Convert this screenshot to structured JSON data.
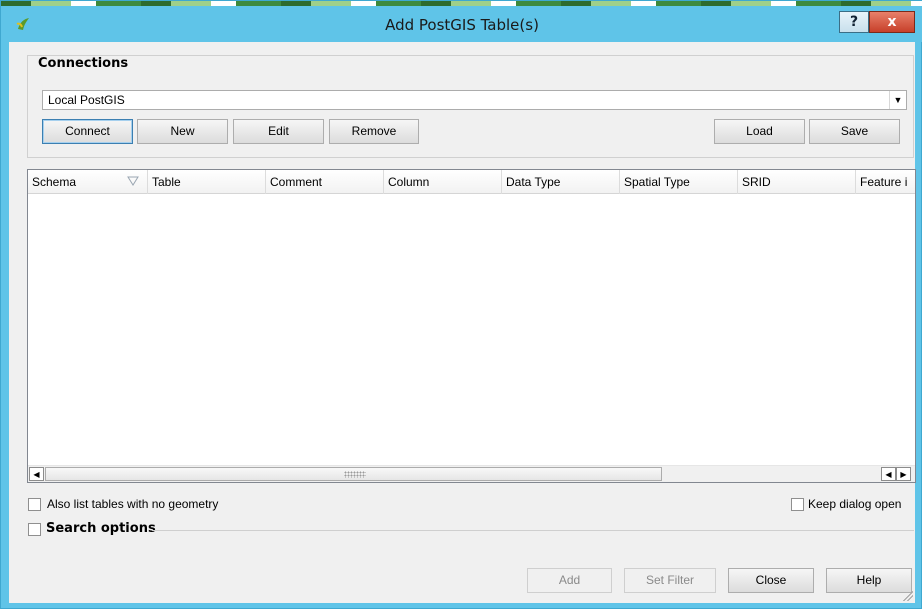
{
  "window": {
    "title": "Add PostGIS Table(s)",
    "help_label": "?",
    "close_label": "x"
  },
  "connections": {
    "group_label": "Connections",
    "selected": "Local PostGIS",
    "buttons": {
      "connect": "Connect",
      "new": "New",
      "edit": "Edit",
      "remove": "Remove",
      "load": "Load",
      "save": "Save"
    }
  },
  "table": {
    "columns": [
      "Schema",
      "Table",
      "Comment",
      "Column",
      "Data Type",
      "Spatial Type",
      "SRID",
      "Feature i"
    ],
    "rows": []
  },
  "options": {
    "list_no_geometry": "Also list tables with no geometry",
    "keep_dialog_open": "Keep dialog open",
    "search_options": "Search options"
  },
  "footer": {
    "add": "Add",
    "set_filter": "Set Filter",
    "close": "Close",
    "help": "Help"
  },
  "colors": {
    "titlebar": "#5fc4e8",
    "close_button": "#c7402a",
    "dialog_bg": "#f0f0f0"
  },
  "icons": {
    "app": "qgis-icon",
    "sort": "sort-indicator-icon",
    "combo": "dropdown-arrow-icon"
  }
}
